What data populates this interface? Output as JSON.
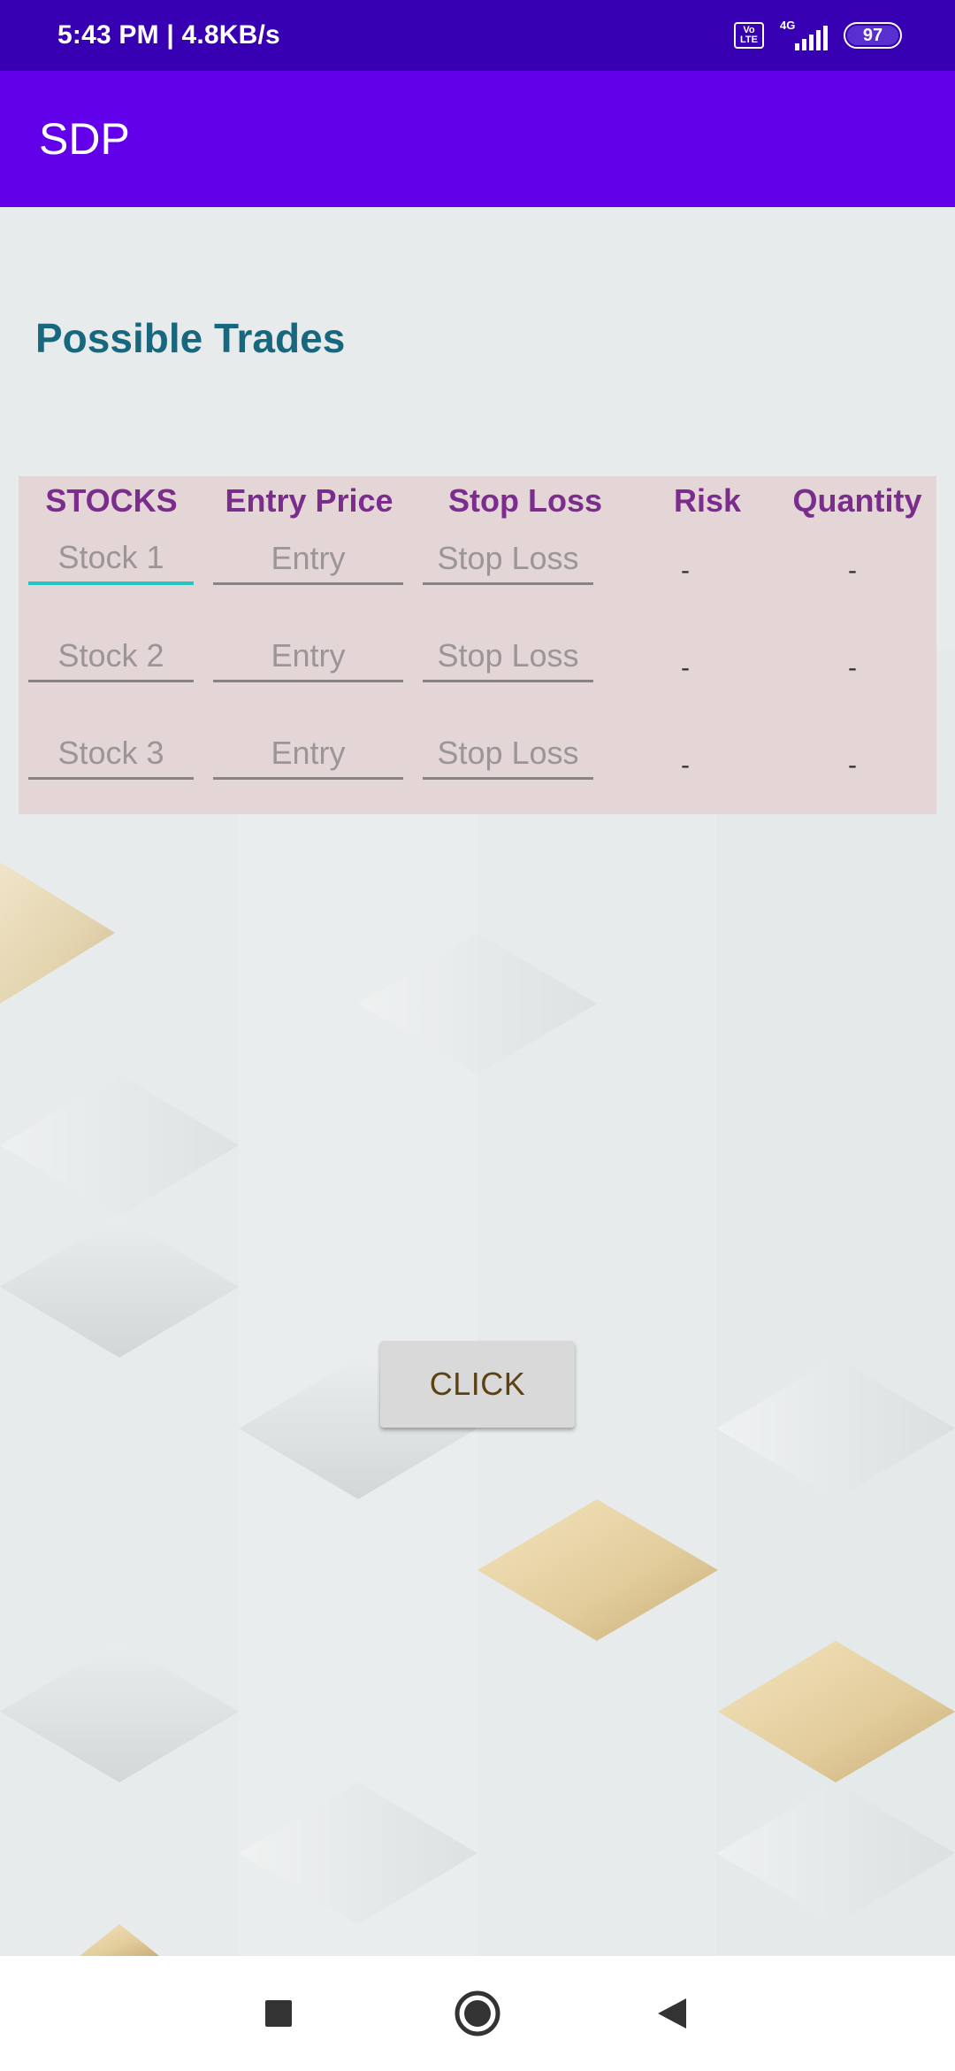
{
  "status_bar": {
    "time_speed": "5:43 PM | 4.8KB/s",
    "volte_top": "Vo",
    "volte_bottom": "LTE",
    "network": "4G",
    "battery": "97"
  },
  "app_bar": {
    "title": "SDP"
  },
  "page": {
    "heading": "Possible Trades"
  },
  "table": {
    "headers": [
      "STOCKS",
      "Entry Price",
      "Stop Loss",
      "Risk",
      "Quantity"
    ],
    "rows": [
      {
        "stock_placeholder": "Stock 1",
        "entry_placeholder": "Entry",
        "stop_placeholder": "Stop Loss",
        "risk": "-",
        "quantity": "-"
      },
      {
        "stock_placeholder": "Stock 2",
        "entry_placeholder": "Entry",
        "stop_placeholder": "Stop Loss",
        "risk": "-",
        "quantity": "-"
      },
      {
        "stock_placeholder": "Stock 3",
        "entry_placeholder": "Entry",
        "stop_placeholder": "Stop Loss",
        "risk": "-",
        "quantity": "-"
      }
    ]
  },
  "button": {
    "label": "CLICK"
  },
  "nav": {
    "icons": [
      "recents-icon",
      "home-icon",
      "back-icon"
    ]
  },
  "colors": {
    "status_bar": "#3700b3",
    "app_bar": "#6200ea",
    "heading": "#17687e",
    "table_header": "#7b2d8e",
    "table_bg": "#e4d6d7",
    "focus_accent": "#26c6c0"
  }
}
